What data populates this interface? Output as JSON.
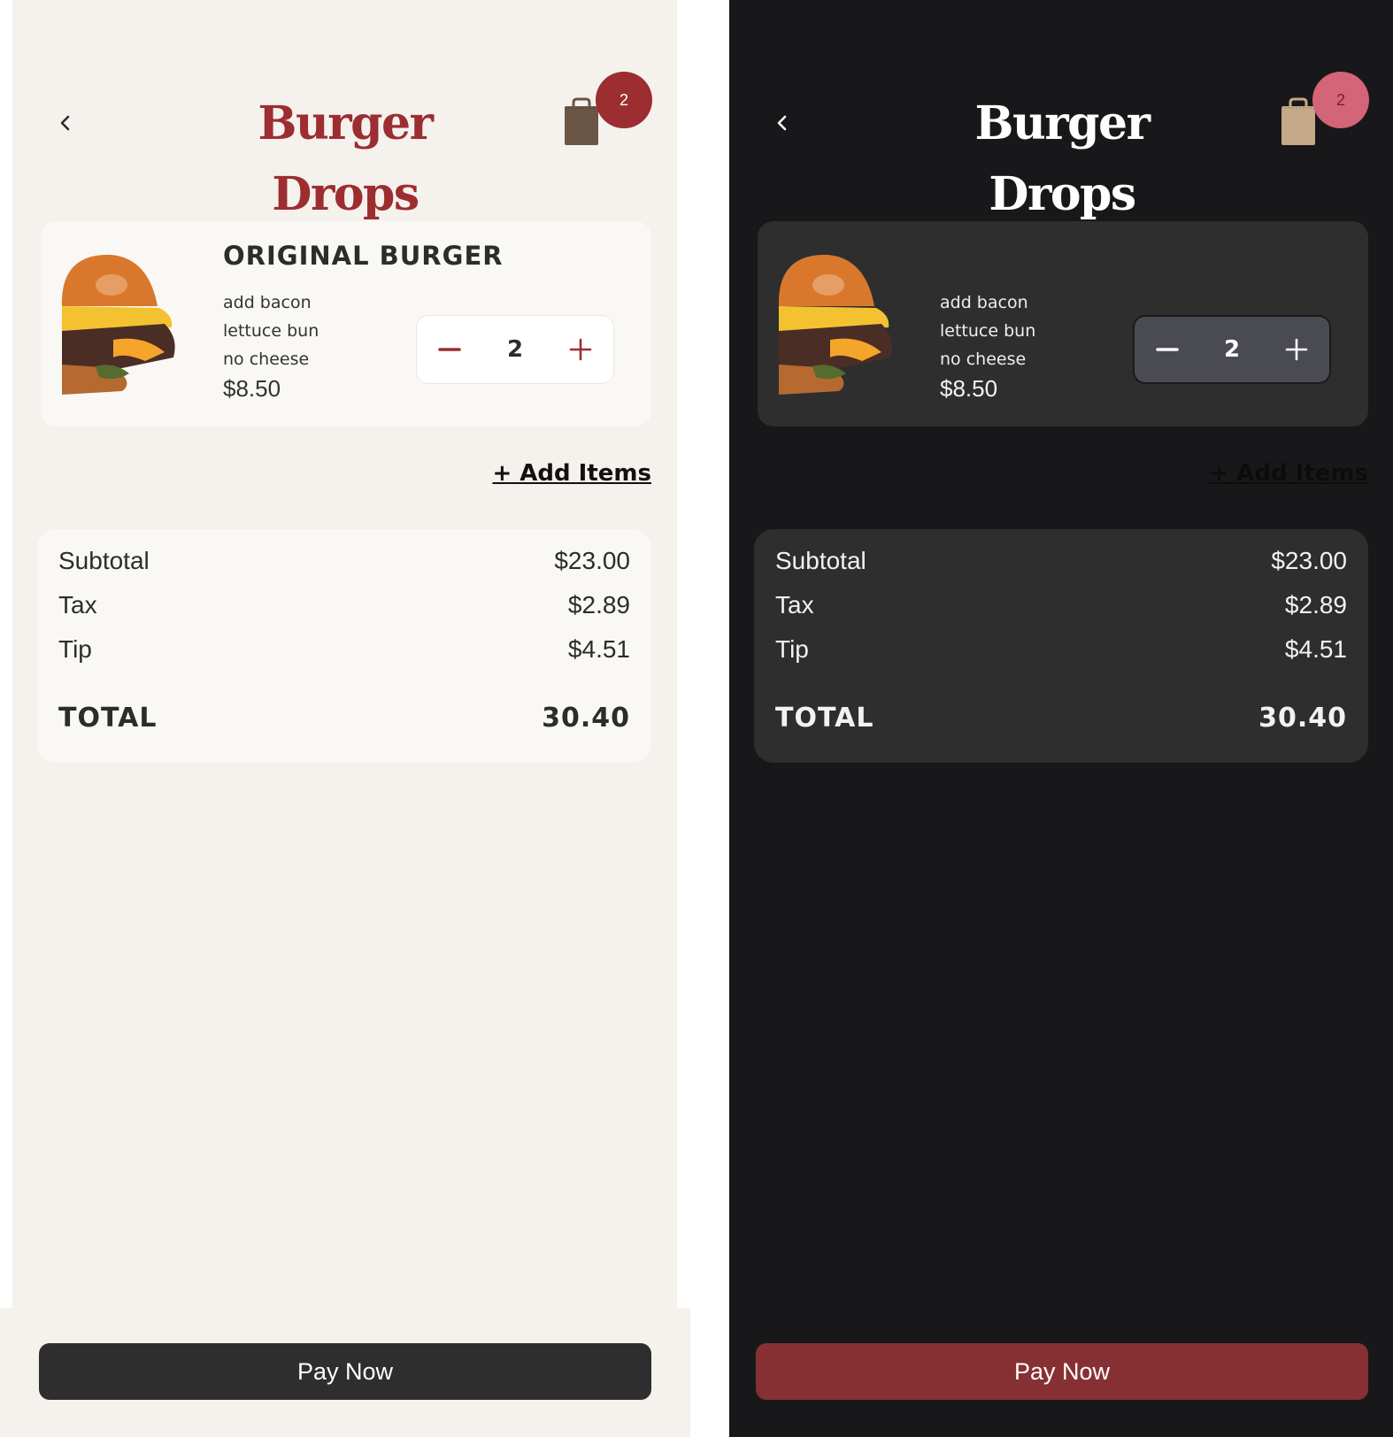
{
  "brand": {
    "title": "Burger Drops"
  },
  "cart": {
    "badge_count": "2"
  },
  "item": {
    "name": "ORIGINAL BURGER",
    "modifiers": [
      "add bacon",
      "lettuce bun",
      "no cheese"
    ],
    "price": "$8.50",
    "quantity": "2"
  },
  "actions": {
    "add_items": "+ Add Items",
    "pay": "Pay Now"
  },
  "summary": {
    "subtotal_label": "Subtotal",
    "subtotal_value": "$23.00",
    "tax_label": "Tax",
    "tax_value": "$2.89",
    "tip_label": "Tip",
    "tip_value": "$4.51",
    "total_label": "TOTAL",
    "total_value": "30.40"
  },
  "themes": {
    "light": {
      "background": "#f5f1ed",
      "card": "#faf8f5",
      "accent": "#9c2d31",
      "bag": "#6b5646",
      "pay_button": "#2e2e2e"
    },
    "dark": {
      "background": "#18181a",
      "card": "#2e2e2f",
      "accent": "#d46477",
      "bag": "#c4a888",
      "pay_button": "#873034"
    }
  },
  "icons": {
    "back": "chevron-left-icon",
    "cart": "shopping-bag-icon",
    "decrease": "minus-icon",
    "increase": "plus-icon"
  }
}
